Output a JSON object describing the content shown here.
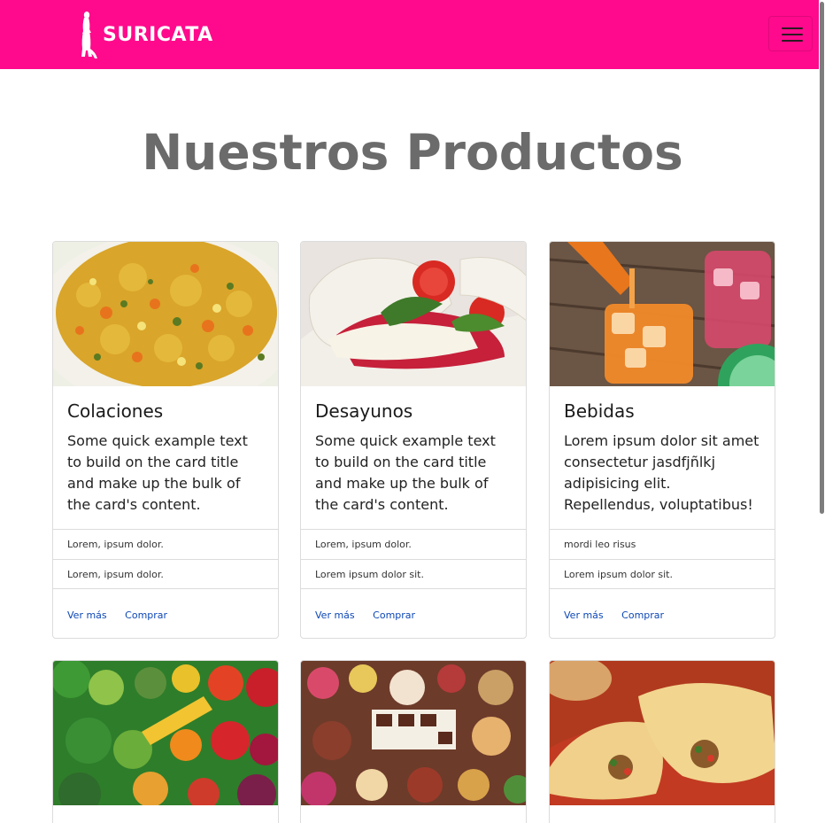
{
  "navbar": {
    "brand": "SURICATA",
    "menu_icon": "hamburger-icon",
    "background": "#ff0a8c"
  },
  "page_title": "Nuestros Productos",
  "cards": [
    {
      "title": "Colaciones",
      "text": "Some quick example text to build on the card title and make up the bulk of the card's content.",
      "items": [
        "Lorem, ipsum dolor.",
        "Lorem, ipsum dolor."
      ],
      "links": [
        "Ver más",
        "Comprar"
      ],
      "image": "food-stew-image"
    },
    {
      "title": "Desayunos",
      "text": "Some quick example text to build on the card title and make up the bulk of the card's content.",
      "items": [
        "Lorem, ipsum dolor.",
        "Lorem ipsum dolor sit."
      ],
      "links": [
        "Ver más",
        "Comprar"
      ],
      "image": "sandwich-image"
    },
    {
      "title": "Bebidas",
      "text": "Lorem ipsum dolor sit amet consectetur jasdfjñlkj adipisicing elit. Repellendus, voluptatibus!",
      "items": [
        "mordi leo risus",
        "Lorem ipsum dolor sit."
      ],
      "links": [
        "Ver más",
        "Comprar"
      ],
      "image": "drinks-image"
    }
  ],
  "cards_row2": [
    {
      "image": "vegetables-image"
    },
    {
      "image": "sweets-image"
    },
    {
      "image": "empanadas-image"
    }
  ]
}
